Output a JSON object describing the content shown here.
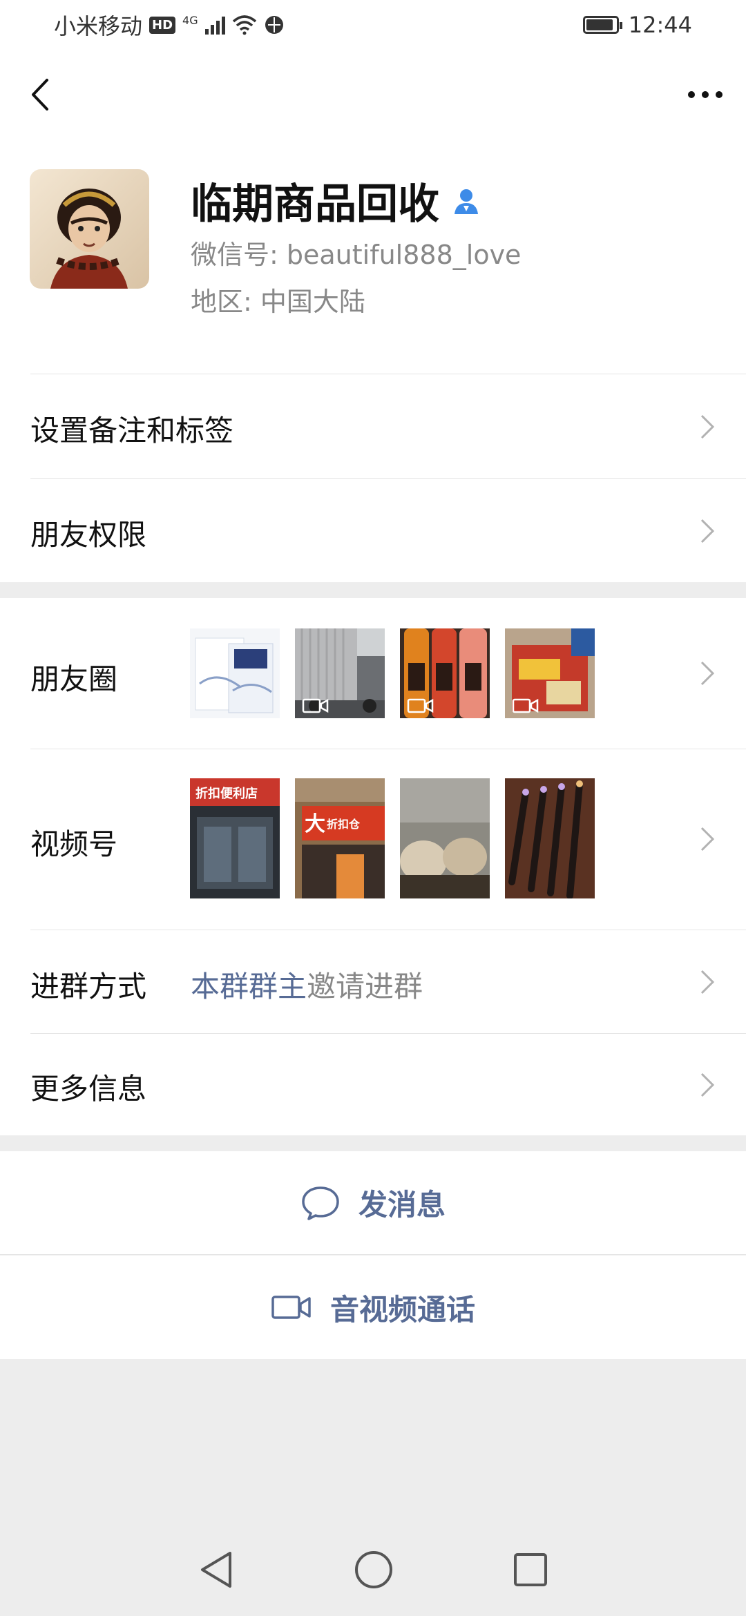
{
  "status_bar": {
    "carrier": "小米移动",
    "hd": "HD",
    "network": "4G",
    "time": "12:44",
    "battery_level": 0.9
  },
  "nav": {
    "back_icon": "back-chevron-icon",
    "more_icon": "more-dots-icon"
  },
  "profile": {
    "name": "临期商品回收",
    "wechat_id": "微信号: beautiful888_love",
    "region": "地区: 中国大陆",
    "badge_icon": "contact-user-icon"
  },
  "rows": {
    "remark": "设置备注和标签",
    "permissions": "朋友权限",
    "moments": "朋友圈",
    "channels": "视频号",
    "join_method_label": "进群方式",
    "join_host": "本群群主",
    "join_rest": "邀请进群",
    "more_info": "更多信息"
  },
  "actions": {
    "message": "发消息",
    "call": "音视频通话"
  },
  "colors": {
    "link": "#576b95",
    "background": "#ededed"
  }
}
